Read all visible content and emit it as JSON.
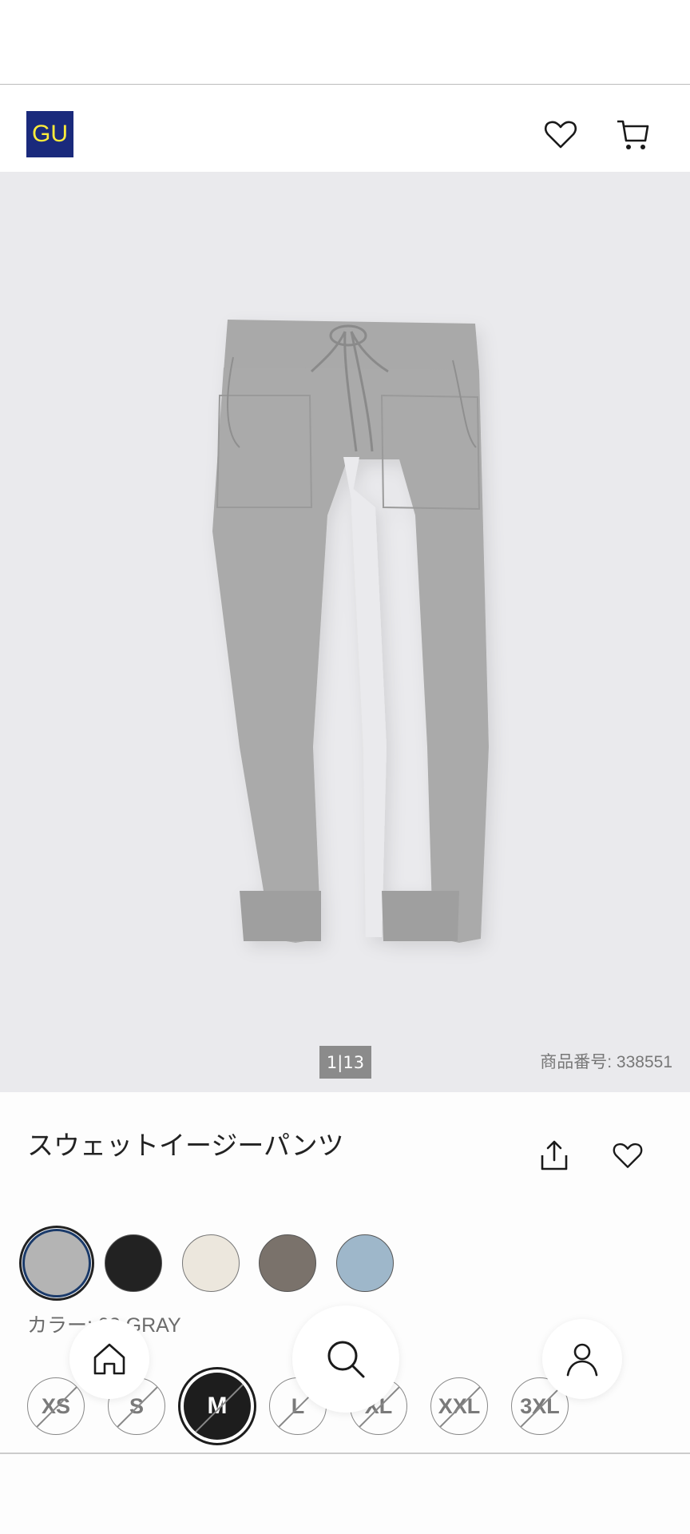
{
  "header": {
    "logo_text": "GU",
    "brand_color": "#1a2a7c",
    "logo_text_color": "#ffec3a",
    "icons": [
      "heart-icon",
      "cart-icon"
    ]
  },
  "gallery": {
    "counter": "1|13",
    "product_number": "商品番号: 338551",
    "image_subject": "gray sweat jogger pants"
  },
  "product": {
    "title": "スウェットイージーパンツ",
    "actions": [
      "share-icon",
      "favorite-icon"
    ]
  },
  "colors": {
    "swatches": [
      {
        "name": "gray",
        "hex": "#b4b4b4",
        "selected": true
      },
      {
        "name": "black",
        "hex": "#222222",
        "selected": false
      },
      {
        "name": "off-white",
        "hex": "#ece7dd",
        "selected": false
      },
      {
        "name": "brown",
        "hex": "#7a726b",
        "selected": false
      },
      {
        "name": "blue",
        "hex": "#9eb7ca",
        "selected": false
      }
    ],
    "label_prefix": "カラー: ",
    "label_obscured": "03",
    "label_value": "GRAY"
  },
  "sizes": {
    "items": [
      {
        "label": "XS",
        "available": false,
        "selected": false
      },
      {
        "label": "S",
        "available": false,
        "selected": false
      },
      {
        "label": "M",
        "available": false,
        "selected": true
      },
      {
        "label": "L",
        "available": false,
        "selected": false
      },
      {
        "label": "XL",
        "available": false,
        "selected": false
      },
      {
        "label": "XXL",
        "available": false,
        "selected": false
      },
      {
        "label": "3XL",
        "available": false,
        "selected": false
      }
    ]
  },
  "floating_nav": {
    "items": [
      "home-icon",
      "search-icon",
      "user-icon"
    ]
  }
}
